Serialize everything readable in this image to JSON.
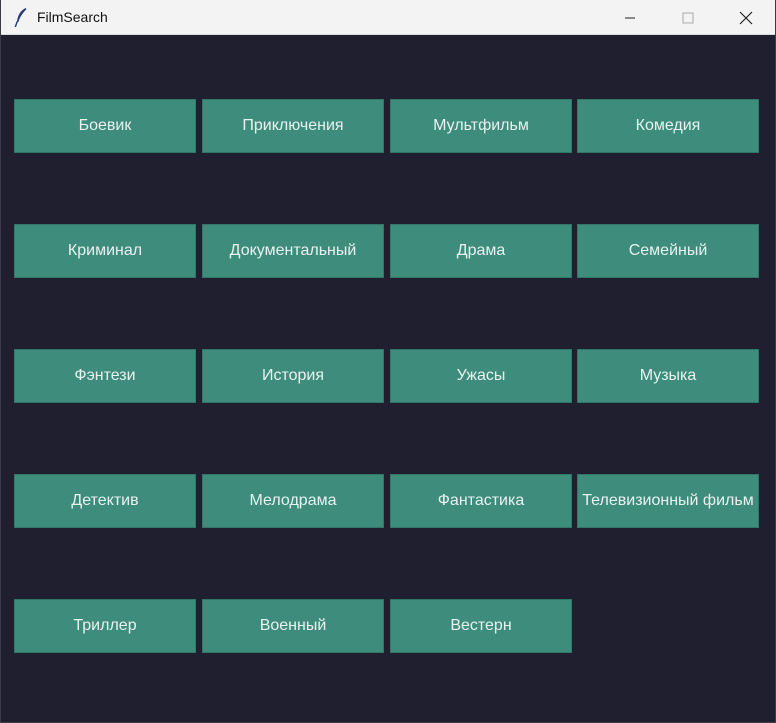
{
  "window": {
    "title": "FilmSearch"
  },
  "icons": {
    "app": "feather-icon",
    "minimize": "minimize-icon",
    "maximize": "maximize-icon",
    "close": "close-icon"
  },
  "colors": {
    "background": "#201f2f",
    "button": "#3d8c7c",
    "button_text": "#e8f2ef",
    "titlebar": "#f3f3f3"
  },
  "genres": [
    "Боевик",
    "Приключения",
    "Мультфильм",
    "Комедия",
    "Криминал",
    "Документальный",
    "Драма",
    "Семейный",
    "Фэнтези",
    "История",
    "Ужасы",
    "Музыка",
    "Детектив",
    "Мелодрама",
    "Фантастика",
    "Телевизионный фильм",
    "Триллер",
    "Военный",
    "Вестерн"
  ]
}
